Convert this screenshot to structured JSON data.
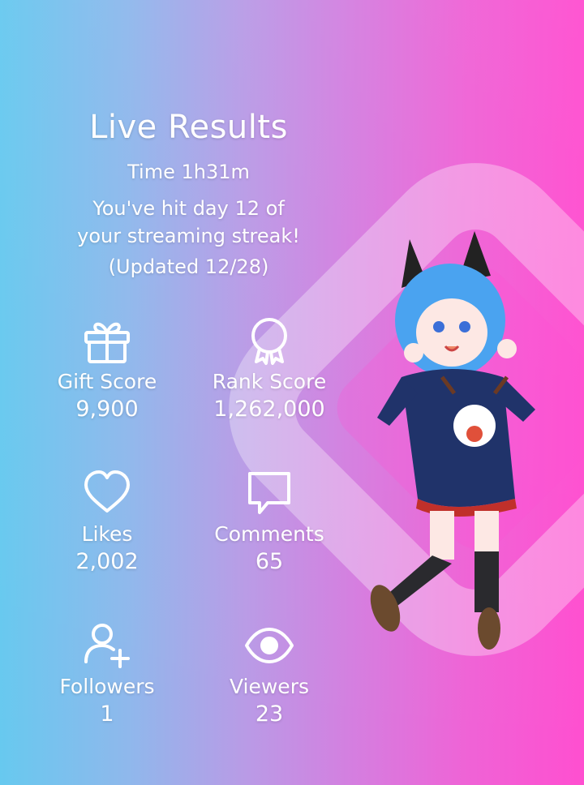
{
  "header": {
    "title": "Live Results",
    "time": "Time 1h31m",
    "streak_line1": "You've hit day 12 of",
    "streak_line2": "your streaming streak!",
    "updated": "(Updated 12/28)"
  },
  "stats": [
    {
      "label": "Gift Score",
      "value": "9,900",
      "icon": "gift-icon"
    },
    {
      "label": "Rank Score",
      "value": "1,262,000",
      "icon": "award-icon"
    },
    {
      "label": "Likes",
      "value": "2,002",
      "icon": "heart-icon"
    },
    {
      "label": "Comments",
      "value": "65",
      "icon": "comment-icon"
    },
    {
      "label": "Followers",
      "value": "1",
      "icon": "add-user-icon"
    },
    {
      "label": "Viewers",
      "value": "23",
      "icon": "eye-icon"
    }
  ],
  "colors": {
    "gradient_left": "#67c9ef",
    "gradient_right": "#ff4fd0",
    "text": "#ffffff"
  }
}
